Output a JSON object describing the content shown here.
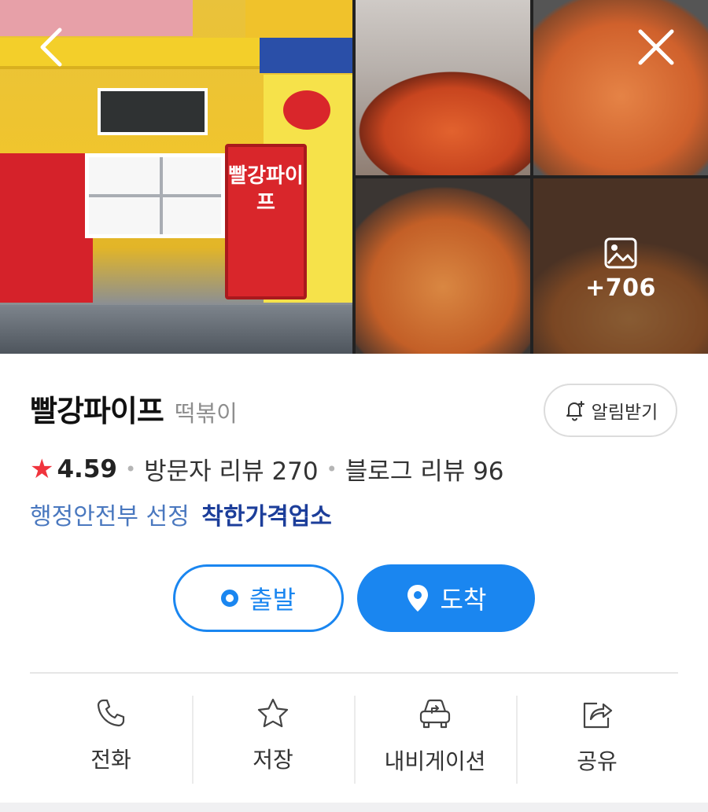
{
  "gallery": {
    "more_count": "+706",
    "store_sign_text": "빨강파이프"
  },
  "header": {
    "back_icon": "chevron-left-icon",
    "close_icon": "close-icon"
  },
  "place": {
    "name": "빨강파이프",
    "category": "떡볶이",
    "alarm_label": "알림받기",
    "rating": "4.59",
    "visitor_reviews": "방문자 리뷰 270",
    "blog_reviews": "블로그 리뷰 96",
    "cert_prefix": "행정안전부 선정",
    "cert_main": "착한가격업소"
  },
  "route": {
    "depart_label": "출발",
    "arrive_label": "도착"
  },
  "actions": [
    {
      "label": "전화",
      "icon": "phone-icon"
    },
    {
      "label": "저장",
      "icon": "star-icon"
    },
    {
      "label": "내비게이션",
      "icon": "car-navigation-icon"
    },
    {
      "label": "공유",
      "icon": "share-icon"
    }
  ],
  "colors": {
    "accent": "#1a86f0",
    "star": "#f0343d",
    "cert_link": "#1c3e9a"
  }
}
